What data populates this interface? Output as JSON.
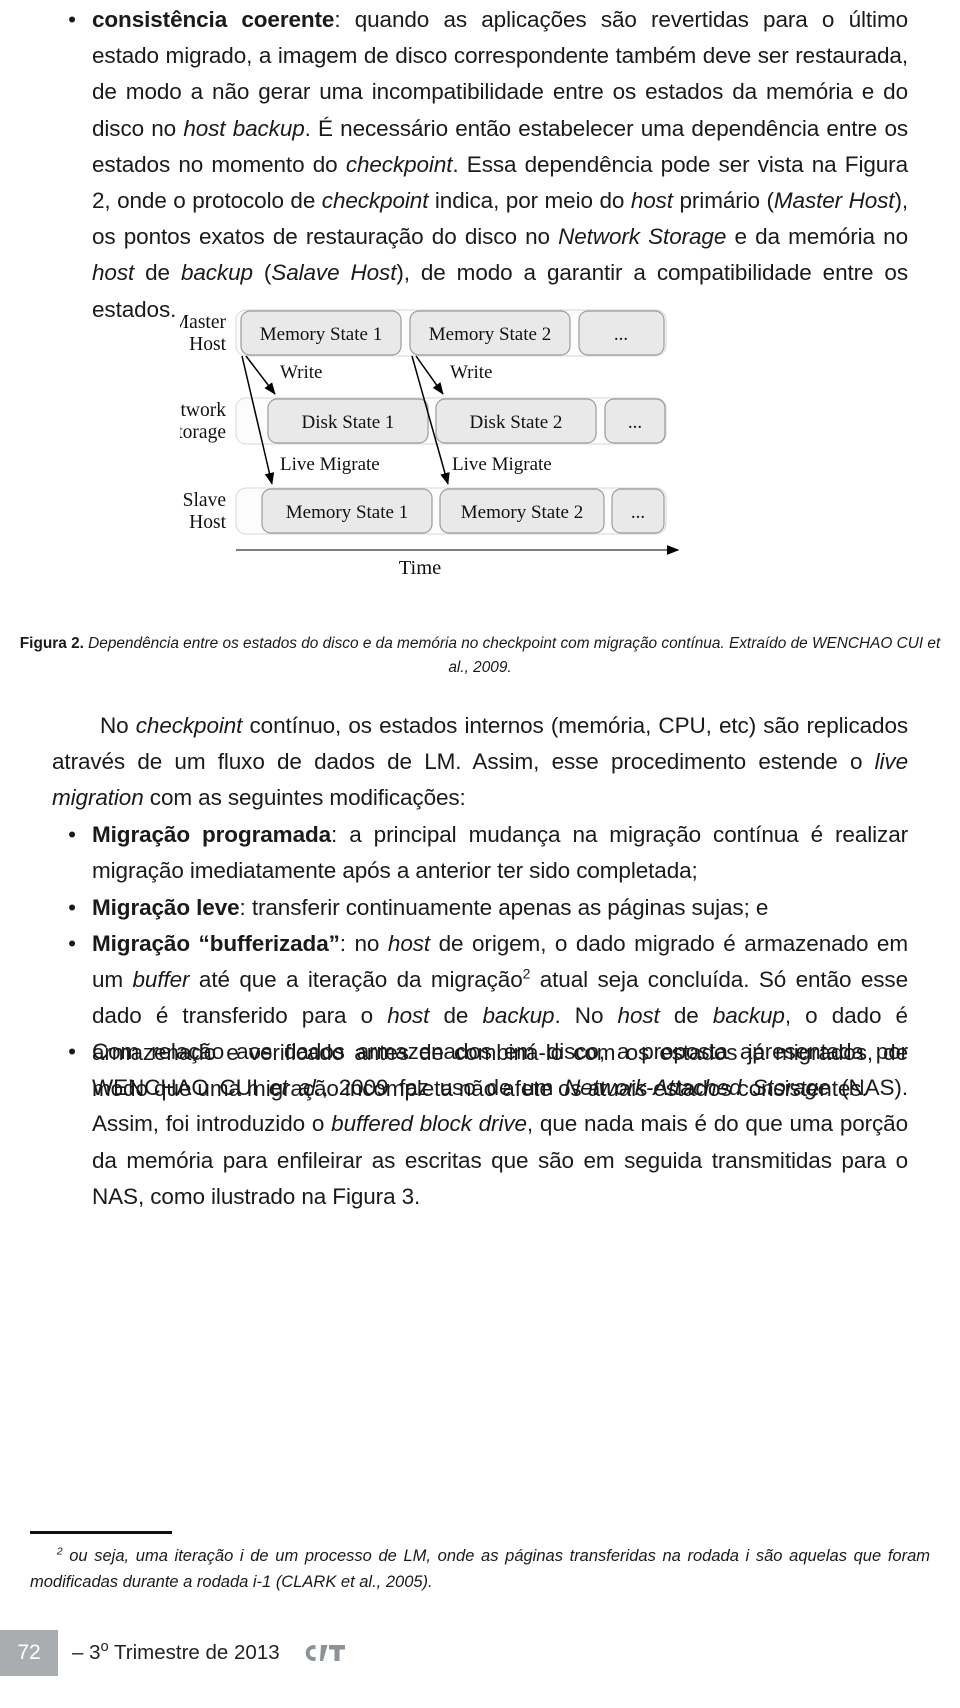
{
  "document": {
    "page_number": "72",
    "footer_text": "– 3o Trimestre de 2013",
    "footer_text_prefix": "– 3",
    "footer_text_ordinal": "o",
    "footer_text_suffix": " Trimestre de 2013",
    "logo_text": "C&T"
  },
  "paragraphs": {
    "bullet_coerente": {
      "bullet": "•",
      "lead_bold": "consistência coerente",
      "rest_1": ": quando as aplicações são revertidas para o último estado migrado, a imagem de disco correspondente também deve ser restaurada, de modo a não gerar uma incompatibilidade entre os estados da memória e do disco no ",
      "it_1": "host backup",
      "rest_2": ". É necessário então estabelecer uma dependência entre os estados no momento do ",
      "it_2": "checkpoint",
      "rest_3": ". Essa dependência pode ser vista na Figura 2, onde o protocolo de ",
      "it_3": "checkpoint",
      "rest_4": " indica, por meio do ",
      "it_4": "host",
      "rest_5": " primário (",
      "it_5": "Master Host",
      "rest_6": "), os pontos exatos de restauração do disco no ",
      "it_6": "Network Storage",
      "rest_7": " e da memória no ",
      "it_7": "host",
      "rest_8": " de ",
      "it_8": "backup",
      "rest_9": " (",
      "it_9": "Salave Host",
      "rest_10": "), de modo a garantir a compatibilidade entre os estados."
    },
    "checkpoint_continuo": {
      "t1": "No ",
      "i1": "checkpoint",
      "t2": " contínuo, os estados internos (memória, CPU, etc) são replicados através de um fluxo de dados de LM. Assim, esse procedimento estende o ",
      "i2": "live migration",
      "t3": " com as seguintes modificações:"
    },
    "bullet_programada": {
      "bullet": "•",
      "lead_bold": "Migração programada",
      "rest": ": a principal mudança na migração contínua é realizar migração imediatamente após a anterior ter sido completada;"
    },
    "bullet_leve": {
      "bullet": "•",
      "lead_bold": "Migração leve",
      "rest": ": transferir continuamente apenas as páginas sujas; e"
    },
    "bullet_bufferizada": {
      "bullet": "•",
      "lead_bold": "Migração “bufferizada”",
      "t1": ": no ",
      "i1": "host",
      "t2": " de origem, o dado migrado é armazenado em um ",
      "i2": "buffer",
      "t3": " até que a iteração da migração",
      "footnote_marker": "2",
      "t4": " atual seja concluída. Só então esse dado é transferido para o ",
      "i3": "host",
      "t5": " de ",
      "i4": "backup",
      "t6": ". No ",
      "i5": "host",
      "t7": " de ",
      "i6": "backup",
      "t8": ", o dado é armazenado e verificado antes de combiná-lo com os estados já migrados, de modo que uma migração incompleta não afete os atuais estados consistentes."
    },
    "bullet_disco": {
      "bullet": "•",
      "t1": "Com relação aos dados armazenados em disco, a proposta apresentada por WENCHAO CUI ",
      "i1": "et al.",
      "t2": ", 2009 faz uso de um ",
      "i2": "Network-Attached Storage",
      "t3": " (NAS). Assim, foi introduzido o ",
      "i3": "buffered block drive",
      "t4": ", que nada mais é do que uma porção da memória para enfileirar as escritas que são em seguida transmitidas para o NAS, como ilustrado na Figura 3."
    }
  },
  "figure": {
    "caption_lead": "Figura 2.",
    "caption_text": " Dependência entre os estados do disco e da memória no checkpoint com migração contínua. Extraído de WENCHAO CUI et al., 2009.",
    "axis_label": "Time",
    "rows": [
      {
        "label_line1": "Master",
        "label_line2": "Host",
        "boxes": [
          "Memory State 1",
          "Memory State 2",
          "..."
        ]
      },
      {
        "label_line1": "Network",
        "label_line2": "Storage",
        "boxes": [
          "Disk State 1",
          "Disk State 2",
          "..."
        ]
      },
      {
        "label_line1": "Slave",
        "label_line2": "Host",
        "boxes": [
          "Memory State 1",
          "Memory State 2",
          "..."
        ]
      }
    ],
    "arrow_labels": {
      "write_1": "Write",
      "write_2": "Write",
      "live_migrate_1": "Live Migrate",
      "live_migrate_2": "Live Migrate"
    },
    "colors": {
      "box_fill": "#e8e8e8",
      "box_stroke": "#9a9a9a",
      "band_fill": "#fbfbfb",
      "arrow": "#000000"
    }
  },
  "footnote": {
    "marker": "2",
    "t1": " ou seja, uma iteração i de um processo de LM, onde as páginas transferidas na rodada i são aquelas que foram modificadas durante a rodada i-1 (CLARK et al., 2005)."
  }
}
